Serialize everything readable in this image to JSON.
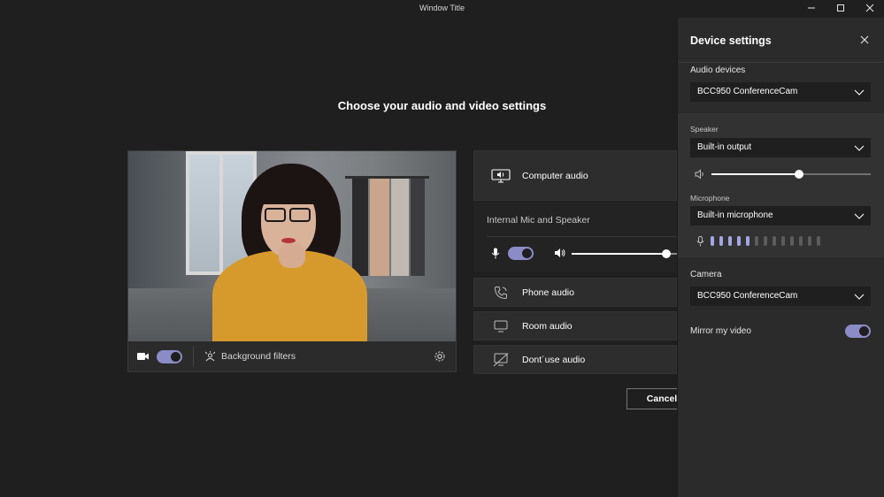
{
  "window": {
    "title": "Window Title",
    "minimize_label": "—",
    "maximize_label": "☐",
    "close_label": "✕"
  },
  "main": {
    "heading": "Choose your audio and video settings"
  },
  "preview": {
    "camera_on": true,
    "background_filters_label": "Background filters"
  },
  "audio_options": {
    "computer_audio_label": "Computer audio",
    "internal_label": "Internal Mic and Speaker",
    "mic_on": true,
    "volume_level": 0.9,
    "phone_audio_label": "Phone audio",
    "room_audio_label": "Room audio",
    "no_audio_label": "Dont´use audio"
  },
  "buttons": {
    "cancel_label": "Cancel"
  },
  "device_settings": {
    "title": "Device settings",
    "audio_devices_label": "Audio devices",
    "audio_device_value": "BCC950 ConferenceCam",
    "speaker_label": "Speaker",
    "speaker_value": "Built-in output",
    "speaker_volume": 0.55,
    "microphone_label": "Microphone",
    "microphone_value": "Built-in microphone",
    "mic_level_active_bars": 5,
    "mic_level_total_bars": 13,
    "camera_label": "Camera",
    "camera_value": "BCC950 ConferenceCam",
    "mirror_label": "Mirror my video",
    "mirror_on": true
  },
  "colors": {
    "accent": "#8b8cc7",
    "panel_bg": "#2b2b2b",
    "page_bg": "#1f1f1f"
  }
}
